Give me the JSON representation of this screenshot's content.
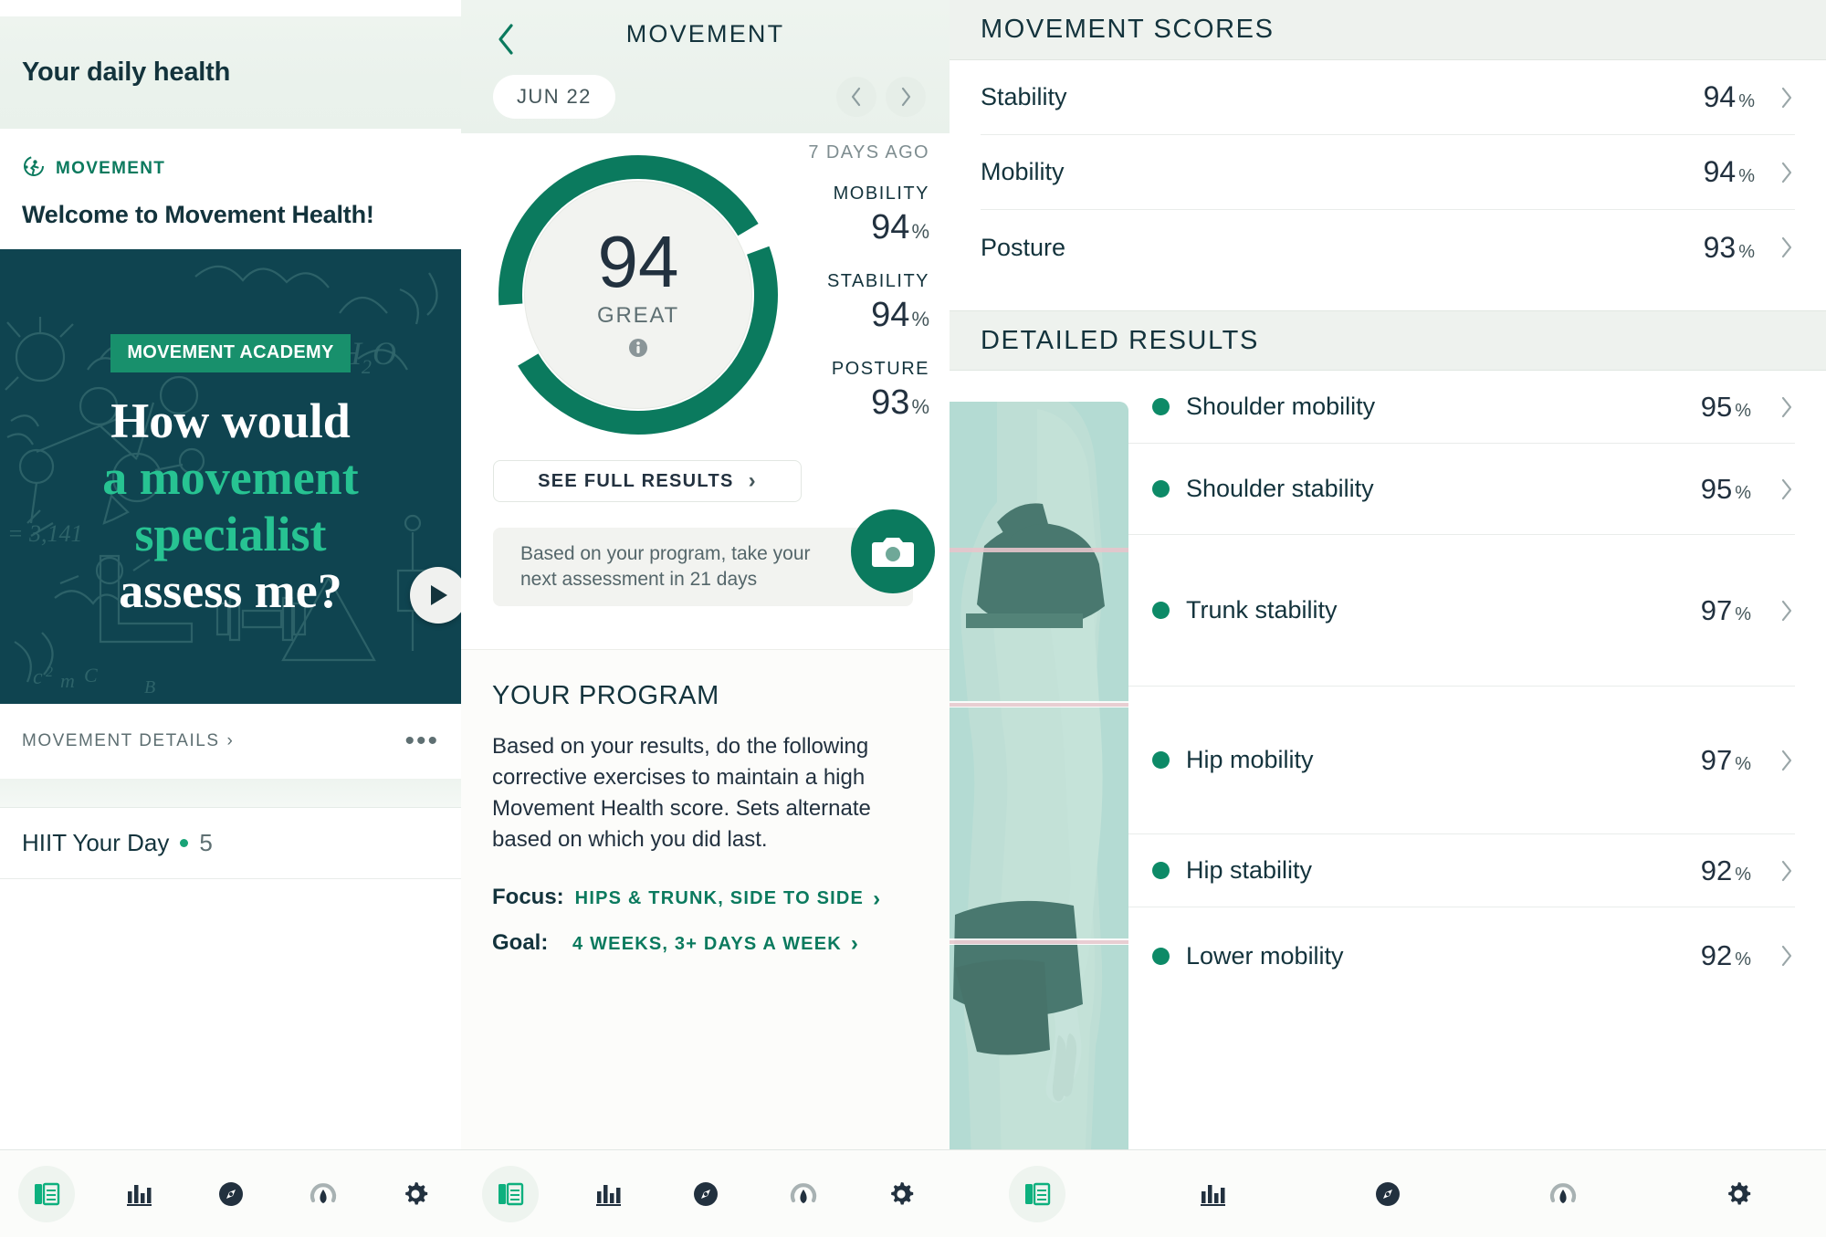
{
  "left": {
    "header_title": "Your daily health",
    "kicker": "MOVEMENT",
    "welcome": "Welcome to Movement Health!",
    "promo": {
      "badge": "MOVEMENT ACADEMY",
      "line1": "How would",
      "line2": "a movement",
      "line3": "specialist",
      "line4": "assess me?"
    },
    "details_label": "MOVEMENT DETAILS",
    "details_chevron": "›",
    "more_dots": "•••",
    "row": {
      "title": "HIIT Your Day",
      "count": "5"
    }
  },
  "middle": {
    "title": "MOVEMENT",
    "back_glyph": "‹",
    "date": "JUN 22",
    "prev_glyph": "‹",
    "next_glyph": "›",
    "score": "94",
    "score_label": "GREAT",
    "ago": "7 DAYS AGO",
    "stats": [
      {
        "key": "MOBILITY",
        "value": "94",
        "unit": "%"
      },
      {
        "key": "STABILITY",
        "value": "94",
        "unit": "%"
      },
      {
        "key": "POSTURE",
        "value": "93",
        "unit": "%"
      }
    ],
    "full_results_label": "SEE FULL RESULTS",
    "full_results_chevron": "›",
    "assessment_note": "Based on your program, take your next assessment in 21 days",
    "program": {
      "title": "YOUR PROGRAM",
      "body": "Based on your results, do the following corrective exercises to maintain a high Movement Health score. Sets alternate based on which you did last.",
      "focus_key": "Focus:",
      "focus_value": "HIPS & TRUNK, SIDE TO SIDE",
      "goal_key": "Goal:",
      "goal_value": "4 WEEKS, 3+ DAYS A WEEK",
      "chevron": "›"
    }
  },
  "right": {
    "scores_title": "MOVEMENT SCORES",
    "scores": [
      {
        "label": "Stability",
        "value": "94",
        "unit": "%"
      },
      {
        "label": "Mobility",
        "value": "94",
        "unit": "%"
      },
      {
        "label": "Posture",
        "value": "93",
        "unit": "%"
      }
    ],
    "detailed_title": "DETAILED RESULTS",
    "detailed": [
      {
        "label": "Shoulder mobility",
        "value": "95",
        "unit": "%"
      },
      {
        "label": "Shoulder stability",
        "value": "95",
        "unit": "%"
      },
      {
        "label": "Trunk stability",
        "value": "97",
        "unit": "%"
      },
      {
        "label": "Hip mobility",
        "value": "97",
        "unit": "%"
      },
      {
        "label": "Hip stability",
        "value": "92",
        "unit": "%"
      },
      {
        "label": "Lower mobility",
        "value": "92",
        "unit": "%"
      }
    ],
    "chevron": "›"
  },
  "navbar": {
    "items": [
      {
        "icon": "dashboard-icon",
        "active": true
      },
      {
        "icon": "bar-chart-icon",
        "active": false
      },
      {
        "icon": "compass-icon",
        "active": false
      },
      {
        "icon": "drop-gauge-icon",
        "active": false
      },
      {
        "icon": "gear-icon",
        "active": false
      }
    ]
  },
  "colors": {
    "brand_green": "#0b7a5e",
    "accent_green": "#27c392",
    "dark_teal": "#0f4450",
    "ink": "#13333c"
  }
}
